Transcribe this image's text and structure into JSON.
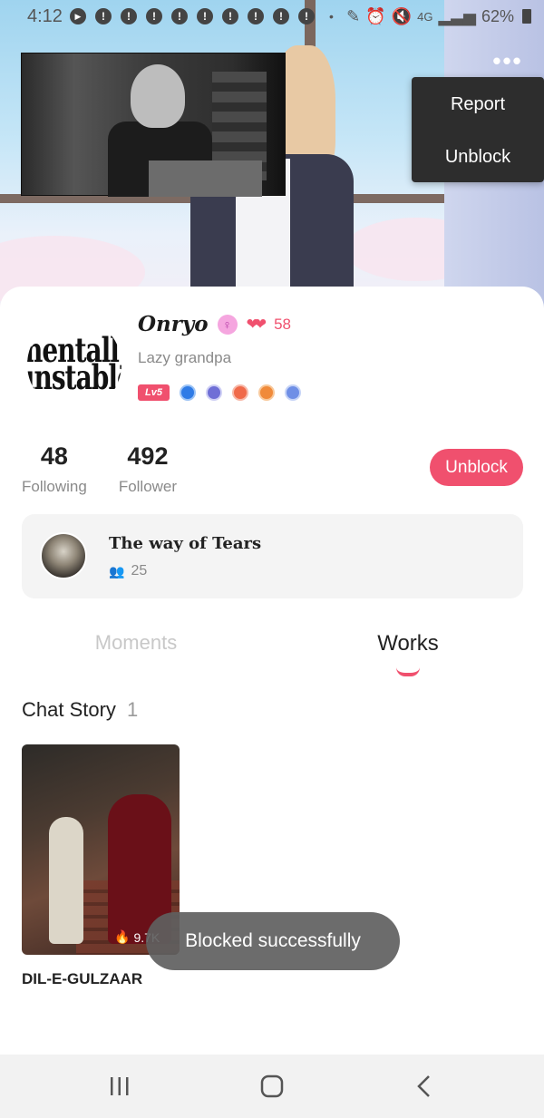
{
  "status_bar": {
    "time": "4:12",
    "network": "4G",
    "battery": "62%"
  },
  "menu": {
    "items": [
      "Report",
      "Unblock"
    ]
  },
  "profile": {
    "avatar_text": [
      "mentally",
      "unstable"
    ],
    "name": "Onryo",
    "heart_count": "58",
    "bio": "Lazy grandpa",
    "level": "Lv5",
    "stats": {
      "following_count": "48",
      "following_label": "Following",
      "follower_count": "492",
      "follower_label": "Follower"
    },
    "unblock_label": "Unblock"
  },
  "fanclub": {
    "title": "The way of Tears",
    "members": "25"
  },
  "tabs": {
    "moments": "Moments",
    "works": "Works",
    "active": "works"
  },
  "section": {
    "title": "Chat Story",
    "count": "1"
  },
  "stories": [
    {
      "title": "DIL-E-GULZAAR",
      "views": "9.7K"
    }
  ],
  "toast": "Blocked successfully",
  "colors": {
    "accent": "#f0506e",
    "menu_bg": "#2d2d2d",
    "toast_bg": "#5f5f5f"
  },
  "icons": [
    "play-icon",
    "alert-icon",
    "wifi-icon",
    "signal-icon",
    "battery-icon",
    "more-icon",
    "female-icon",
    "hearts-icon",
    "people-icon",
    "flame-icon",
    "recents-icon",
    "home-icon",
    "back-icon"
  ]
}
